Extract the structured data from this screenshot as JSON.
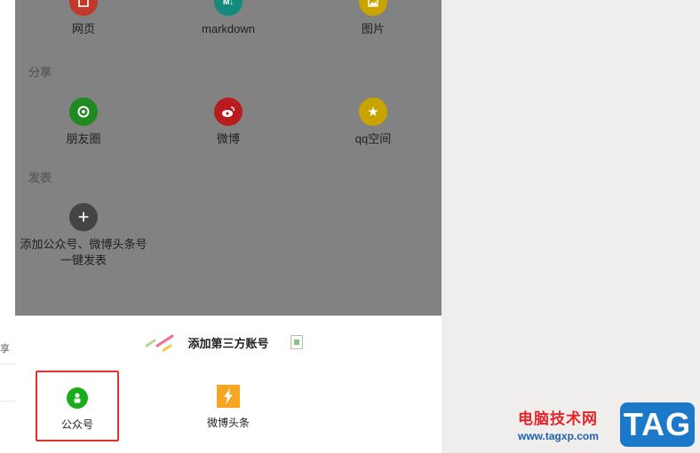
{
  "left_fragment": "享",
  "export_items": [
    {
      "label": "网页",
      "icon": "webpage-icon",
      "color": "#c0392b"
    },
    {
      "label": "markdown",
      "icon": "markdown-icon",
      "color": "#138a7c"
    },
    {
      "label": "图片",
      "icon": "image-icon",
      "color": "#c9a300"
    }
  ],
  "share_title": "分享",
  "share_items": [
    {
      "label": "朋友圈",
      "icon": "moments-icon",
      "color": "#1f8a1f"
    },
    {
      "label": "微博",
      "icon": "weibo-icon",
      "color": "#b81c1c"
    },
    {
      "label": "qq空间",
      "icon": "qzone-icon",
      "color": "#c9a300"
    }
  ],
  "publish_title": "发表",
  "publish_item": {
    "label": "添加公众号、微博头条号\n一键发表",
    "icon": "plus-icon",
    "color": "#444444"
  },
  "bottom_sheet": {
    "title": "添加第三方账号",
    "accounts": [
      {
        "label": "公众号",
        "icon": "wechat-official-account-icon",
        "color": "#1aad19",
        "selected": true
      },
      {
        "label": "微博头条",
        "icon": "weibo-headline-icon",
        "color": "#f5a623",
        "selected": false
      }
    ]
  },
  "watermark": {
    "cn": "电脑技术网",
    "url": "www.tagxp.com",
    "tag": "TAG"
  }
}
